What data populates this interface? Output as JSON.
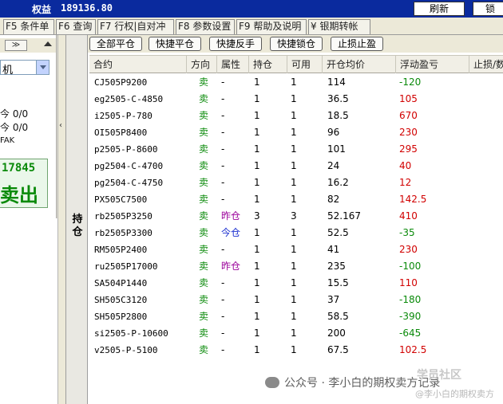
{
  "topbar": {
    "equity_label": "权益",
    "equity_value": "189136.80",
    "refresh_label": "刷新",
    "lock_label": "锁"
  },
  "tabs": [
    {
      "label": "F5 条件单"
    },
    {
      "label": "F6 查询"
    },
    {
      "label": "F7 行权|自对冲"
    },
    {
      "label": "F8 参数设置"
    },
    {
      "label": "F9 帮助及说明"
    },
    {
      "label": "¥ 银期转帐"
    }
  ],
  "left_panel": {
    "chevron": "≫",
    "select_value": "机",
    "line1": "今 0/0",
    "line2": "今 0/0",
    "line3": "FAK",
    "big_number": "17845",
    "big_action": "卖出"
  },
  "side_tab": {
    "label": "持仓"
  },
  "toolbar": {
    "close_all": "全部平仓",
    "quick_close": "快捷平仓",
    "quick_reverse": "快捷反手",
    "quick_lock": "快捷锁仓",
    "stop_loss_profit": "止损止盈"
  },
  "table": {
    "headers": [
      "合约",
      "方向",
      "属性",
      "持仓",
      "可用",
      "开仓均价",
      "浮动盈亏",
      "止损/数"
    ],
    "rows": [
      {
        "symbol": "CJ505P9200",
        "dir": "卖",
        "attr": "-",
        "hold": "1",
        "avail": "1",
        "price": "114",
        "pl": "-120"
      },
      {
        "symbol": "eg2505-C-4850",
        "dir": "卖",
        "attr": "-",
        "hold": "1",
        "avail": "1",
        "price": "36.5",
        "pl": "105"
      },
      {
        "symbol": "i2505-P-780",
        "dir": "卖",
        "attr": "-",
        "hold": "1",
        "avail": "1",
        "price": "18.5",
        "pl": "670"
      },
      {
        "symbol": "OI505P8400",
        "dir": "卖",
        "attr": "-",
        "hold": "1",
        "avail": "1",
        "price": "96",
        "pl": "230"
      },
      {
        "symbol": "p2505-P-8600",
        "dir": "卖",
        "attr": "-",
        "hold": "1",
        "avail": "1",
        "price": "101",
        "pl": "295"
      },
      {
        "symbol": "pg2504-C-4700",
        "dir": "卖",
        "attr": "-",
        "hold": "1",
        "avail": "1",
        "price": "24",
        "pl": "40"
      },
      {
        "symbol": "pg2504-C-4750",
        "dir": "卖",
        "attr": "-",
        "hold": "1",
        "avail": "1",
        "price": "16.2",
        "pl": "12"
      },
      {
        "symbol": "PX505C7500",
        "dir": "卖",
        "attr": "-",
        "hold": "1",
        "avail": "1",
        "price": "82",
        "pl": "142.5"
      },
      {
        "symbol": "rb2505P3250",
        "dir": "卖",
        "attr": "昨仓",
        "hold": "3",
        "avail": "3",
        "price": "52.167",
        "pl": "410"
      },
      {
        "symbol": "rb2505P3300",
        "dir": "卖",
        "attr": "今仓",
        "hold": "1",
        "avail": "1",
        "price": "52.5",
        "pl": "-35"
      },
      {
        "symbol": "RM505P2400",
        "dir": "卖",
        "attr": "-",
        "hold": "1",
        "avail": "1",
        "price": "41",
        "pl": "230"
      },
      {
        "symbol": "ru2505P17000",
        "dir": "卖",
        "attr": "昨仓",
        "hold": "1",
        "avail": "1",
        "price": "235",
        "pl": "-100"
      },
      {
        "symbol": "SA504P1440",
        "dir": "卖",
        "attr": "-",
        "hold": "1",
        "avail": "1",
        "price": "15.5",
        "pl": "110"
      },
      {
        "symbol": "SH505C3120",
        "dir": "卖",
        "attr": "-",
        "hold": "1",
        "avail": "1",
        "price": "37",
        "pl": "-180"
      },
      {
        "symbol": "SH505P2800",
        "dir": "卖",
        "attr": "-",
        "hold": "1",
        "avail": "1",
        "price": "58.5",
        "pl": "-390"
      },
      {
        "symbol": "si2505-P-10600",
        "dir": "卖",
        "attr": "-",
        "hold": "1",
        "avail": "1",
        "price": "200",
        "pl": "-645"
      },
      {
        "symbol": "v2505-P-5100",
        "dir": "卖",
        "attr": "-",
        "hold": "1",
        "avail": "1",
        "price": "67.5",
        "pl": "102.5"
      }
    ]
  },
  "watermark": {
    "text": "公众号 · 李小白的期权卖方记录",
    "corner_top": "学员社区",
    "corner_bottom": "@李小白的期权卖方"
  },
  "colors": {
    "topbar_bg": "#0a2a9e",
    "profit": "#d10000",
    "loss": "#0a8a0a",
    "attr_purple": "#9b009b",
    "attr_blue": "#1a2fd0"
  }
}
